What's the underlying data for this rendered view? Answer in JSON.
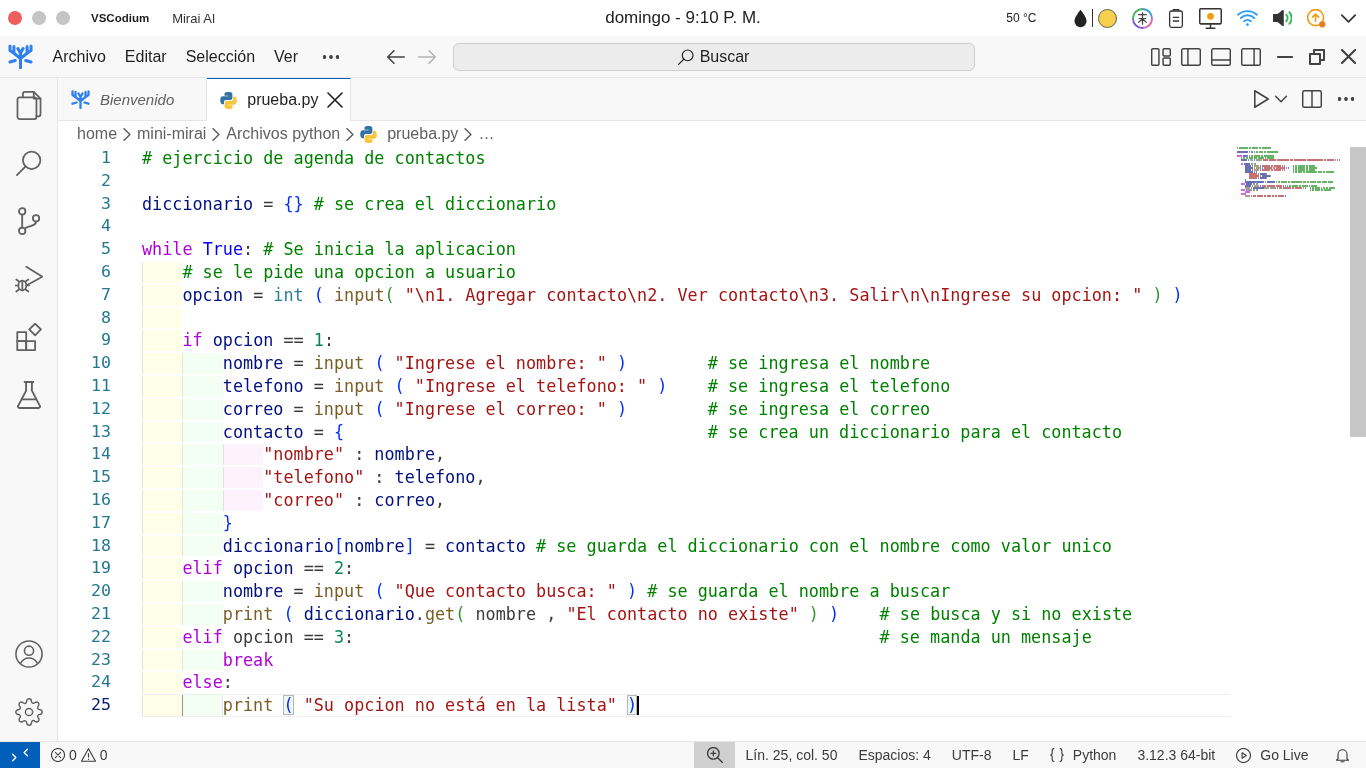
{
  "system_bar": {
    "app_name": "VSCodium",
    "window_name": "Mirai AI",
    "clock": "domingo - 9:10 P. M.",
    "temperature": "50 °C"
  },
  "menu_bar": {
    "menus": [
      "Archivo",
      "Editar",
      "Selección",
      "Ver"
    ],
    "navigation": [
      {
        "kind": "back",
        "disabled": false
      },
      {
        "kind": "forward",
        "disabled": true
      }
    ],
    "command_center": {
      "label": "Buscar"
    }
  },
  "tabs": [
    {
      "label": "Bienvenido",
      "kind": "welcome",
      "preview": true,
      "selected": false
    },
    {
      "label": "prueba.py",
      "kind": "python",
      "preview": false,
      "selected": true
    }
  ],
  "breadcrumb": [
    {
      "label": "home",
      "kind": "folder"
    },
    {
      "label": "mini-mirai",
      "kind": "folder"
    },
    {
      "label": "Archivos python",
      "kind": "folder"
    },
    {
      "label": "prueba.py",
      "kind": "python"
    },
    {
      "label": "…",
      "kind": "more"
    }
  ],
  "editor": {
    "lines": [
      {
        "number": "1",
        "current": false,
        "tokens": [
          {
            "text": "# ejercicio de agenda de contactos",
            "kind": "comment"
          }
        ]
      },
      {
        "number": "2",
        "current": false
      },
      {
        "number": "3",
        "current": false,
        "tokens": [
          {
            "text": "diccionario",
            "kind": "variable"
          },
          {
            "text": " = ",
            "kind": "plain"
          },
          {
            "text": "{",
            "kind": "bracket"
          },
          {
            "text": "}",
            "kind": "bracket"
          },
          {
            "text": " # se crea el diccionario",
            "kind": "comment"
          }
        ]
      },
      {
        "number": "4",
        "current": false
      },
      {
        "number": "5",
        "current": false,
        "tokens": [
          {
            "text": "while ",
            "kind": "keyword"
          },
          {
            "text": "True",
            "kind": "constant"
          },
          {
            "text": ": ",
            "kind": "plain"
          },
          {
            "text": "# Se inicia la aplicacion",
            "kind": "comment"
          }
        ]
      },
      {
        "number": "6",
        "current": false,
        "tokens": [
          {
            "text": "    # se le pide una opcion a usuario",
            "kind": "comment"
          }
        ]
      },
      {
        "number": "7",
        "current": false,
        "tokens": [
          {
            "text": "    opcion",
            "kind": "variable"
          },
          {
            "text": " = ",
            "kind": "plain"
          },
          {
            "text": "int ",
            "kind": "class"
          },
          {
            "text": "( ",
            "kind": "bracket"
          },
          {
            "text": "input",
            "kind": "function"
          },
          {
            "text": "( ",
            "kind": "bracket"
          },
          {
            "text": "\"\\n1. Agregar contacto\\n2. Ver contacto\\n3. Salir\\n\\nIngrese su opcion: \" ",
            "kind": "string"
          },
          {
            "text": ") ",
            "kind": "bracket"
          },
          {
            "text": ")",
            "kind": "bracket"
          }
        ]
      },
      {
        "number": "8",
        "current": false
      },
      {
        "number": "9",
        "current": false,
        "tokens": [
          {
            "text": "    if ",
            "kind": "keyword"
          },
          {
            "text": "opcion",
            "kind": "variable"
          },
          {
            "text": " == ",
            "kind": "plain"
          },
          {
            "text": "1",
            "kind": "number"
          },
          {
            "text": ":",
            "kind": "plain"
          }
        ]
      },
      {
        "number": "10",
        "current": false,
        "tokens": [
          {
            "text": "        nombre",
            "kind": "variable"
          },
          {
            "text": " = ",
            "kind": "plain"
          },
          {
            "text": "input ",
            "kind": "function"
          },
          {
            "text": "( ",
            "kind": "bracket"
          },
          {
            "text": "\"Ingrese el nombre: \" ",
            "kind": "string"
          },
          {
            "text": ")        ",
            "kind": "bracket"
          },
          {
            "text": "# se ingresa el nombre",
            "kind": "comment"
          }
        ]
      },
      {
        "number": "11",
        "current": false,
        "tokens": [
          {
            "text": "        telefono",
            "kind": "variable"
          },
          {
            "text": " = ",
            "kind": "plain"
          },
          {
            "text": "input ",
            "kind": "function"
          },
          {
            "text": "( ",
            "kind": "bracket"
          },
          {
            "text": "\"Ingrese el telefono: \" ",
            "kind": "string"
          },
          {
            "text": ")    ",
            "kind": "bracket"
          },
          {
            "text": "# se ingresa el telefono",
            "kind": "comment"
          }
        ]
      },
      {
        "number": "12",
        "current": false,
        "tokens": [
          {
            "text": "        correo",
            "kind": "variable"
          },
          {
            "text": " = ",
            "kind": "plain"
          },
          {
            "text": "input ",
            "kind": "function"
          },
          {
            "text": "( ",
            "kind": "bracket"
          },
          {
            "text": "\"Ingrese el correo: \" ",
            "kind": "string"
          },
          {
            "text": ")        ",
            "kind": "bracket"
          },
          {
            "text": "# se ingresa el correo",
            "kind": "comment"
          }
        ]
      },
      {
        "number": "13",
        "current": false,
        "tokens": [
          {
            "text": "        contacto",
            "kind": "variable"
          },
          {
            "text": " = ",
            "kind": "plain"
          },
          {
            "text": "{                                    ",
            "kind": "bracket"
          },
          {
            "text": "# se crea un diccionario para el contacto",
            "kind": "comment"
          }
        ]
      },
      {
        "number": "14",
        "current": false,
        "tokens": [
          {
            "text": "            \"nombre\"",
            "kind": "string"
          },
          {
            "text": " : ",
            "kind": "plain"
          },
          {
            "text": "nombre",
            "kind": "variable"
          },
          {
            "text": ",",
            "kind": "plain"
          }
        ]
      },
      {
        "number": "15",
        "current": false,
        "tokens": [
          {
            "text": "            \"telefono\"",
            "kind": "string"
          },
          {
            "text": " : ",
            "kind": "plain"
          },
          {
            "text": "telefono",
            "kind": "variable"
          },
          {
            "text": ",",
            "kind": "plain"
          }
        ]
      },
      {
        "number": "16",
        "current": false,
        "tokens": [
          {
            "text": "            \"correo\"",
            "kind": "string"
          },
          {
            "text": " : ",
            "kind": "plain"
          },
          {
            "text": "correo",
            "kind": "variable"
          },
          {
            "text": ",",
            "kind": "plain"
          }
        ]
      },
      {
        "number": "17",
        "current": false,
        "tokens": [
          {
            "text": "        }",
            "kind": "bracket"
          }
        ]
      },
      {
        "number": "18",
        "current": false,
        "tokens": [
          {
            "text": "        diccionario",
            "kind": "variable"
          },
          {
            "text": "[",
            "kind": "bracket"
          },
          {
            "text": "nombre",
            "kind": "variable"
          },
          {
            "text": "]",
            "kind": "bracket"
          },
          {
            "text": " = ",
            "kind": "plain"
          },
          {
            "text": "contacto ",
            "kind": "variable"
          },
          {
            "text": "# se guarda el diccionario con el nombre como valor unico",
            "kind": "comment"
          }
        ]
      },
      {
        "number": "19",
        "current": false,
        "tokens": [
          {
            "text": "    elif ",
            "kind": "keyword"
          },
          {
            "text": "opcion",
            "kind": "variable"
          },
          {
            "text": " == ",
            "kind": "plain"
          },
          {
            "text": "2",
            "kind": "number"
          },
          {
            "text": ":",
            "kind": "plain"
          }
        ]
      },
      {
        "number": "20",
        "current": false,
        "tokens": [
          {
            "text": "        nombre",
            "kind": "variable"
          },
          {
            "text": " = ",
            "kind": "plain"
          },
          {
            "text": "input ",
            "kind": "function"
          },
          {
            "text": "( ",
            "kind": "bracket"
          },
          {
            "text": "\"Que contacto busca: \" ",
            "kind": "string"
          },
          {
            "text": ") ",
            "kind": "bracket"
          },
          {
            "text": "# se guarda el nombre a buscar",
            "kind": "comment"
          }
        ]
      },
      {
        "number": "21",
        "current": false,
        "tokens": [
          {
            "text": "        print ",
            "kind": "function"
          },
          {
            "text": "( ",
            "kind": "bracket"
          },
          {
            "text": "diccionario",
            "kind": "variable"
          },
          {
            "text": ".",
            "kind": "plain"
          },
          {
            "text": "get",
            "kind": "function"
          },
          {
            "text": "( ",
            "kind": "bracket"
          },
          {
            "text": "nombre , ",
            "kind": "plain"
          },
          {
            "text": "\"El contacto no existe\" ",
            "kind": "string"
          },
          {
            "text": ") ",
            "kind": "bracket"
          },
          {
            "text": ")    ",
            "kind": "bracket"
          },
          {
            "text": "# se busca y si no existe",
            "kind": "comment"
          }
        ]
      },
      {
        "number": "22",
        "current": false,
        "tokens": [
          {
            "text": "    elif ",
            "kind": "keyword"
          },
          {
            "text": "opcion == ",
            "kind": "plain"
          },
          {
            "text": "3",
            "kind": "number"
          },
          {
            "text": ":                                                    ",
            "kind": "plain"
          },
          {
            "text": "# se manda un mensaje",
            "kind": "comment"
          }
        ]
      },
      {
        "number": "23",
        "current": false,
        "tokens": [
          {
            "text": "        break",
            "kind": "keyword"
          }
        ]
      },
      {
        "number": "24",
        "current": false,
        "tokens": [
          {
            "text": "    else",
            "kind": "keyword"
          },
          {
            "text": ":",
            "kind": "plain"
          }
        ]
      },
      {
        "number": "25",
        "current": true,
        "tokens": [
          {
            "text": "        print ",
            "kind": "function"
          },
          {
            "text": "( ",
            "kind": "bracket"
          },
          {
            "text": "\"Su opcion no está en la lista\" ",
            "kind": "string"
          },
          {
            "text": ")",
            "kind": "bracket"
          }
        ]
      }
    ]
  },
  "status_bar": {
    "problems": {
      "errors": "0",
      "warnings": "0"
    },
    "items": [
      {
        "kind": "text",
        "label": "Lín. 25, col. 50"
      },
      {
        "kind": "text",
        "label": "Espacios: 4"
      },
      {
        "kind": "text",
        "label": "UTF-8"
      },
      {
        "kind": "text",
        "label": "LF"
      },
      {
        "kind": "language",
        "label": "Python"
      },
      {
        "kind": "text",
        "label": "3.12.3 64-bit"
      },
      {
        "kind": "live",
        "label": "Go Live"
      }
    ]
  }
}
